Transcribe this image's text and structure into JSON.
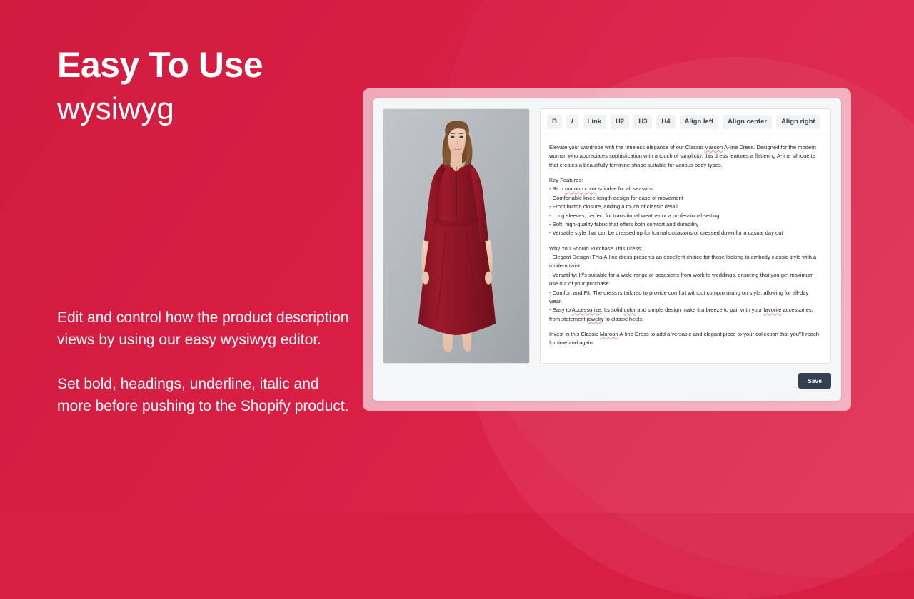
{
  "theme": {
    "background_color": "#d81e43",
    "card_frame_color": "#f6b6c2",
    "card_color": "#f5f6f7",
    "save_button_color": "#343f52",
    "text_color": "#ffffff"
  },
  "marketing": {
    "headline_main": "Easy To Use",
    "headline_sub": "wysiwyg",
    "paragraph_1": "Edit and control how the product description views by using our easy wysiwyg editor.",
    "paragraph_2": "Set bold, headings, underline, italic and more before pushing to the Shopify product."
  },
  "editor": {
    "toolbar": {
      "buttons": [
        {
          "label": "B",
          "name": "bold-button"
        },
        {
          "label": "I",
          "name": "italic-button"
        },
        {
          "label": "Link",
          "name": "link-button"
        },
        {
          "label": "H2",
          "name": "heading-2-button"
        },
        {
          "label": "H3",
          "name": "heading-3-button"
        },
        {
          "label": "H4",
          "name": "heading-4-button"
        },
        {
          "label": "Align left",
          "name": "align-left-button"
        },
        {
          "label": "Align center",
          "name": "align-center-button"
        },
        {
          "label": "Align right",
          "name": "align-right-button"
        }
      ]
    },
    "content": {
      "intro": "Elevate your wardrobe with the timeless elegance of our Classic Maroon A-line Dress. Designed for the modern woman who appreciates sophistication with a touch of simplicity, this dress features a flattering A-line silhouette that creates a beautifully feminine shape suitable for various body types.",
      "features_heading": "Key Features:",
      "features": [
        "- Rich maroon color suitable for all seasons",
        "- Comfortable knee-length design for ease of movement",
        "- Front button closure, adding a touch of classic detail",
        "- Long sleeves, perfect for transitional weather or a professional setting",
        "- Soft, high-quality fabric that offers both comfort and durability",
        "- Versatile style that can be dressed up for formal occasions or dressed down for a casual day out"
      ],
      "purchase_heading": "Why You Should Purchase This Dress:",
      "purchase_reasons": [
        "- Elegant Design: This A-line dress presents an excellent choice for those looking to embody classic style with a modern twist.",
        "- Versatility: It\\'s suitable for a wide range of occasions from work to weddings, ensuring that you get maximum use out of your purchase.",
        "- Comfort and Fit: The dress is tailored to provide comfort without compromising on style, allowing for all-day wear.",
        "- Easy to Accessorize: Its solid color and simple design make it a breeze to pair with your favorite accessories, from statement jewelry to classic heels."
      ],
      "closing": "Invest in this Classic Maroon A-line Dress to add a versatile and elegant piece to your collection that you\\'ll reach for time and again."
    },
    "save_label": "Save",
    "product_image_alt": "Model wearing classic maroon A-line dress"
  }
}
